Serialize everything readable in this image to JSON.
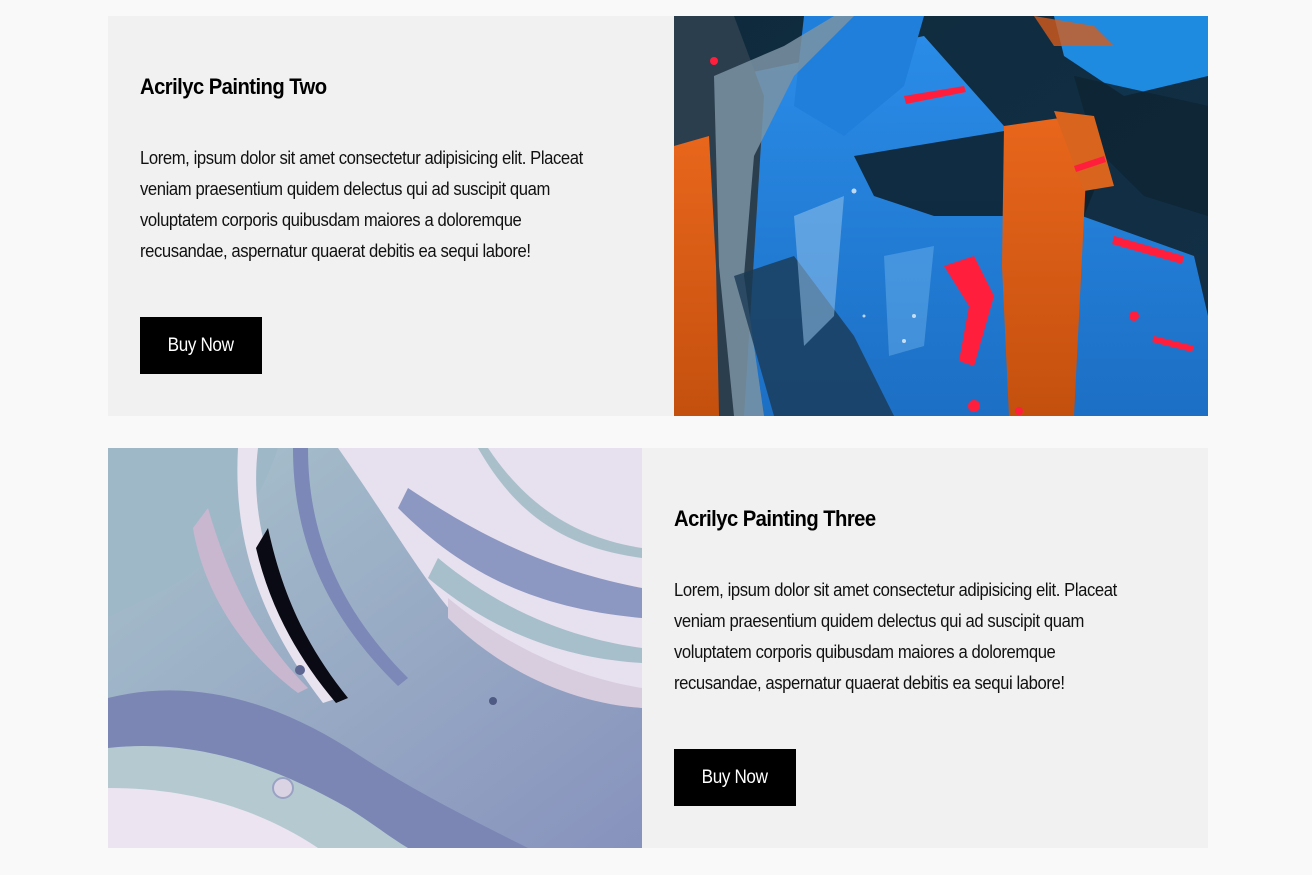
{
  "products": [
    {
      "title": "Acrilyc Painting Two",
      "description": "Lorem, ipsum dolor sit amet consectetur adipisicing elit. Placeat veniam praesentium quidem delectus qui ad suscipit quam voluptatem corporis quibusdam maiores a doloremque recusandae, aspernatur quaerat debitis ea sequi labore!",
      "button_label": "Buy Now",
      "image": {
        "subject": "abstract acrylic painting",
        "colors": [
          "#1d7fd8",
          "#0e2535",
          "#ff6a1a",
          "#ff1e3a"
        ]
      }
    },
    {
      "title": "Acrilyc Painting Three",
      "description": "Lorem, ipsum dolor sit amet consectetur adipisicing elit. Placeat veniam praesentium quidem delectus qui ad suscipit quam voluptatem corporis quibusdam maiores a doloremque recusandae, aspernatur quaerat debitis ea sequi labore!",
      "button_label": "Buy Now",
      "image": {
        "subject": "marbled fluid acrylic paint",
        "colors": [
          "#7f8cb8",
          "#a8c2c8",
          "#e9e1ef",
          "#0a0a14"
        ]
      }
    }
  ]
}
